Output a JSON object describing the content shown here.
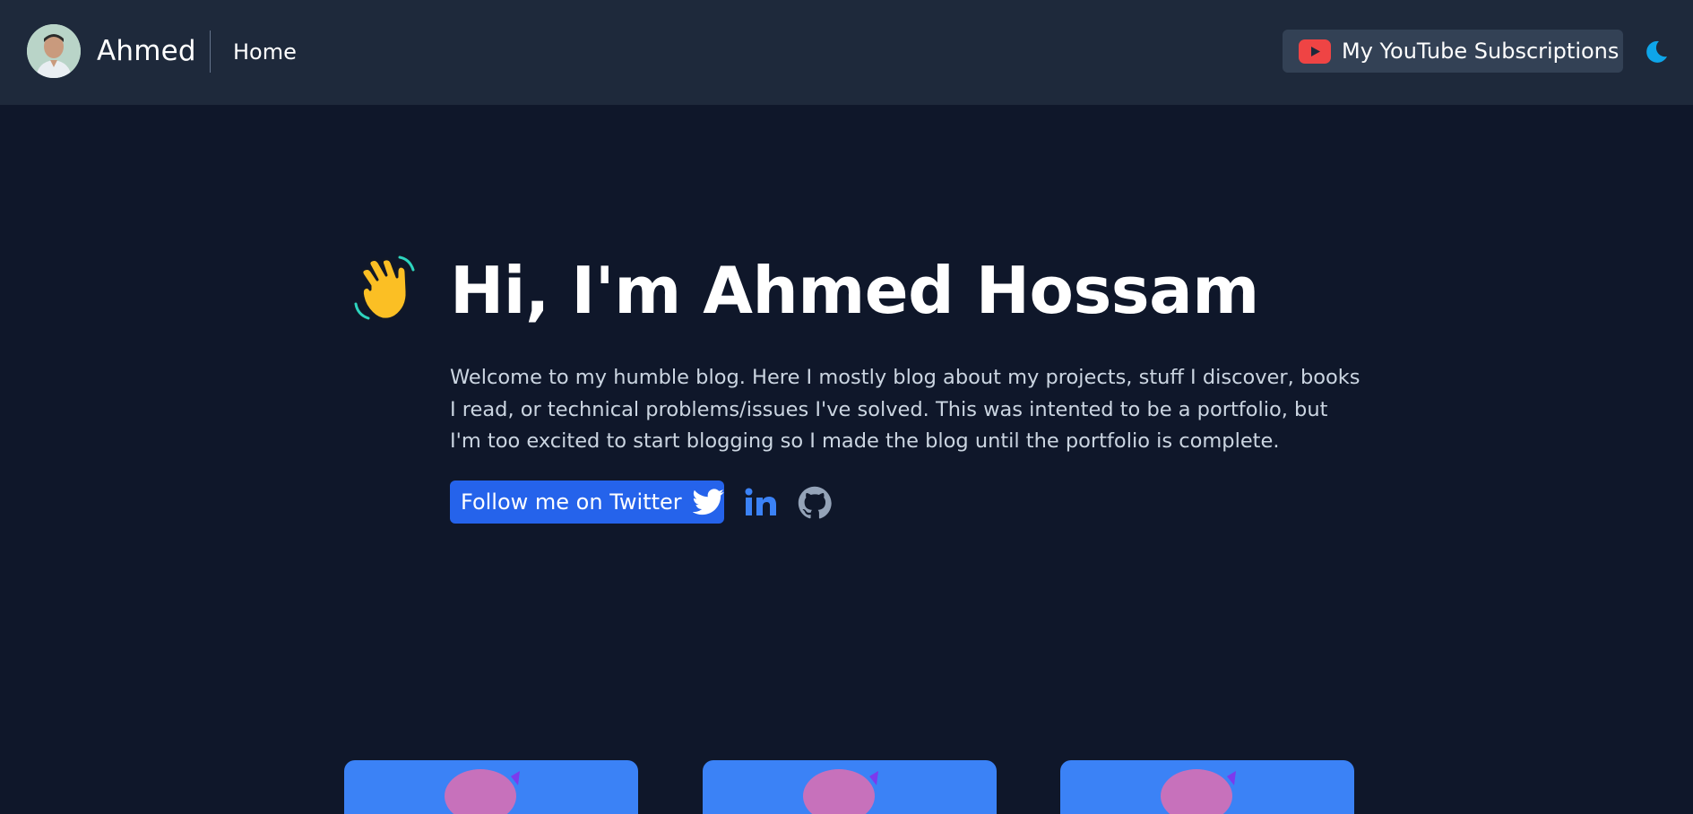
{
  "header": {
    "brand_name": "Ahmed",
    "nav": {
      "home_label": "Home"
    },
    "youtube_button_label": "My YouTube Subscriptions",
    "avatar_icon": "avatar-photo",
    "youtube_icon": "youtube-icon",
    "theme_toggle_icon": "moon-icon"
  },
  "hero": {
    "title": "Hi, I'm Ahmed Hossam",
    "description": "Welcome to my humble blog. Here I mostly blog about my projects, stuff I discover, books I read, or technical problems/issues I've solved. This was intented to be a portfolio, but I'm too excited to start blogging so I made the blog until the portfolio is complete.",
    "wave_icon": "waving-hand-icon",
    "twitter_button_label": "Follow me on Twitter",
    "twitter_icon": "twitter-bird-icon",
    "social_icons": [
      "linkedin-icon",
      "github-icon"
    ]
  },
  "cards": [
    {
      "icon": "card-image"
    },
    {
      "icon": "card-image"
    },
    {
      "icon": "card-image"
    }
  ],
  "colors": {
    "page_background": "#0f172a",
    "header_background": "#1e293b",
    "youtube_button_background": "#334155",
    "twitter_button": "#2563eb",
    "social_icon": "#3b82f6",
    "youtube_red": "#ef4444",
    "moon": "#0ea5e9",
    "text_muted": "#cbd5e1",
    "card_background": "#3b82f6"
  }
}
